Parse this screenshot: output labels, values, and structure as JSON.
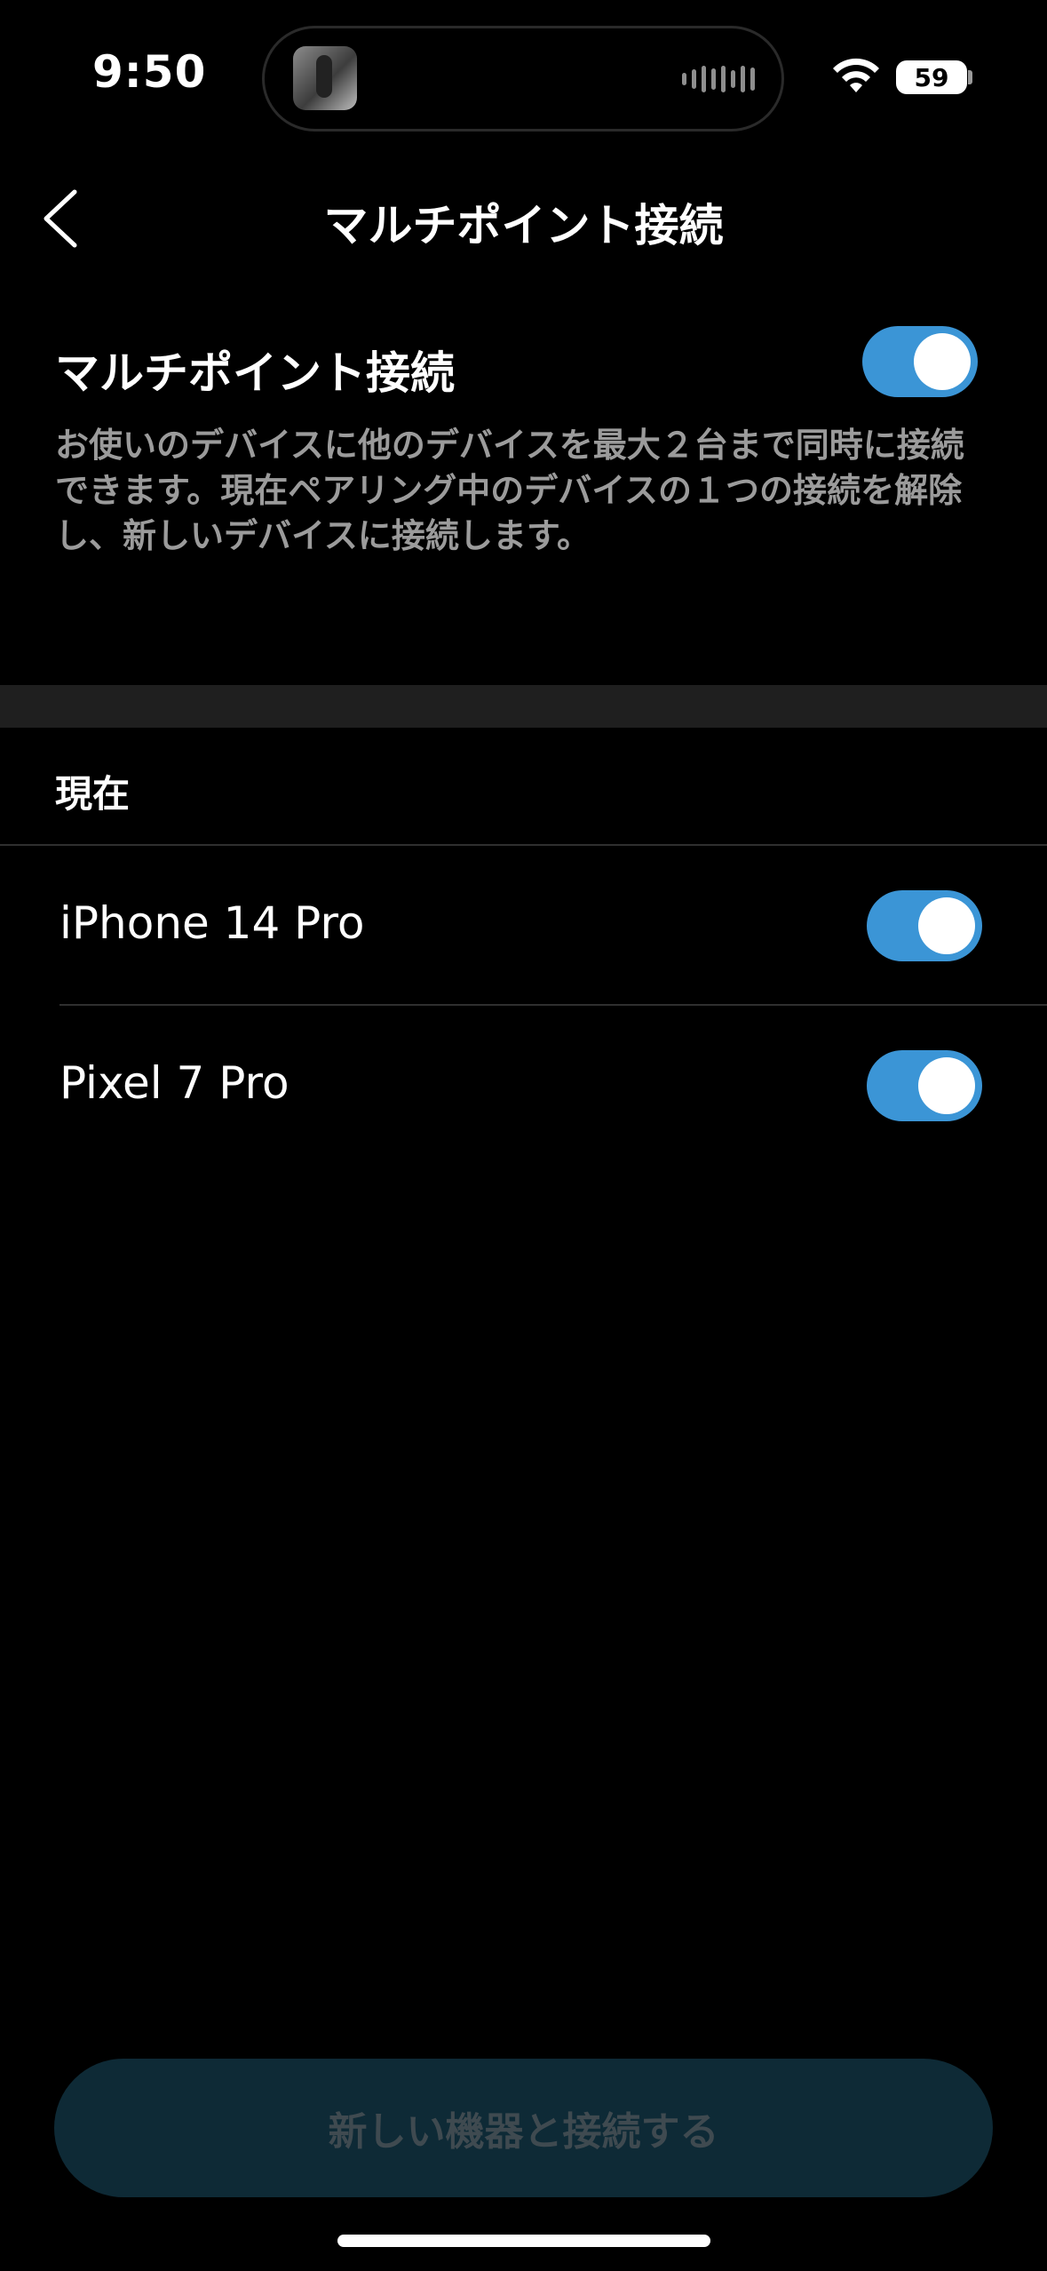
{
  "status_bar": {
    "time": "9:50",
    "battery_level": "59",
    "icons": [
      "now-playing-artwork-icon",
      "audio-waveform-icon",
      "wifi-icon",
      "battery-icon"
    ]
  },
  "header": {
    "title": "マルチポイント接続",
    "back_icon": "chevron-left-icon"
  },
  "multipoint": {
    "label": "マルチポイント接続",
    "enabled": true,
    "description": "お使いのデバイスに他のデバイスを最大２台まで同時に接続できます。現在ペアリング中のデバイスの１つの接続を解除し、新しいデバイスに接続します。"
  },
  "current_section": {
    "header": "現在",
    "devices": [
      {
        "name": "iPhone 14 Pro",
        "connected": true
      },
      {
        "name": "Pixel 7 Pro",
        "connected": true
      }
    ]
  },
  "footer": {
    "connect_button_label": "新しい機器と接続する"
  },
  "colors": {
    "background": "#000000",
    "toggle_on": "#3b95d6",
    "section_gap": "#1f1f1f",
    "button_disabled_bg": "#0e2a36",
    "button_disabled_text": "#3f4a50",
    "secondary_text": "#9b9b9b"
  }
}
